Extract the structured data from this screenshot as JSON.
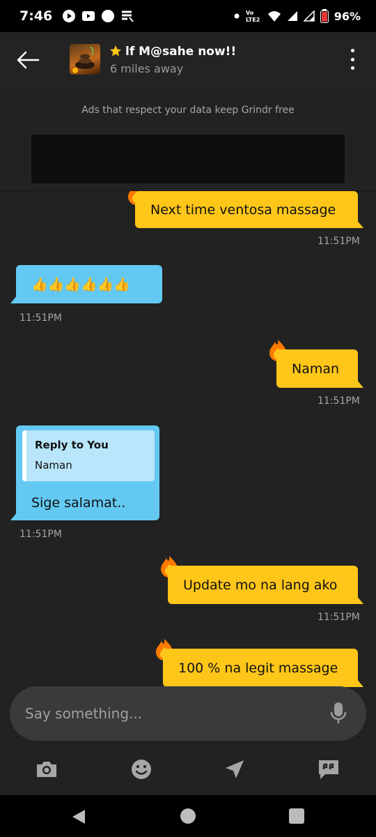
{
  "status_bar": {
    "time": "7:46",
    "network": "Vo)) LTE2",
    "battery": "96%"
  },
  "header": {
    "name": "lf M@sahe now!!",
    "distance": "6 miles away",
    "star_color": "#ffc61a"
  },
  "ad": {
    "note": "Ads that respect your data keep Grindr free"
  },
  "messages": [
    {
      "direction": "out",
      "text": "Next time ventosa massage",
      "time": "11:51PM",
      "flame": true
    },
    {
      "direction": "in",
      "text": "👍👍👍👍👍👍",
      "time": "11:51PM"
    },
    {
      "direction": "out",
      "text": "Naman",
      "time": "11:51PM",
      "flame": true
    },
    {
      "direction": "in",
      "reply_title": "Reply to You",
      "reply_text": "Naman",
      "text": "Sige salamat..",
      "time": "11:51PM"
    },
    {
      "direction": "out",
      "text": "Update mo na lang ako",
      "time": "11:51PM",
      "flame": true
    },
    {
      "direction": "out",
      "text": "100 % na legit massage",
      "flame": true
    }
  ],
  "composer": {
    "placeholder": "Say something..."
  },
  "actions": [
    "camera-icon",
    "emoji-icon",
    "location-icon",
    "saved-phrases-icon"
  ],
  "colors": {
    "outgoing": "#ffc61a",
    "incoming": "#63c9f2",
    "background": "#222222"
  }
}
